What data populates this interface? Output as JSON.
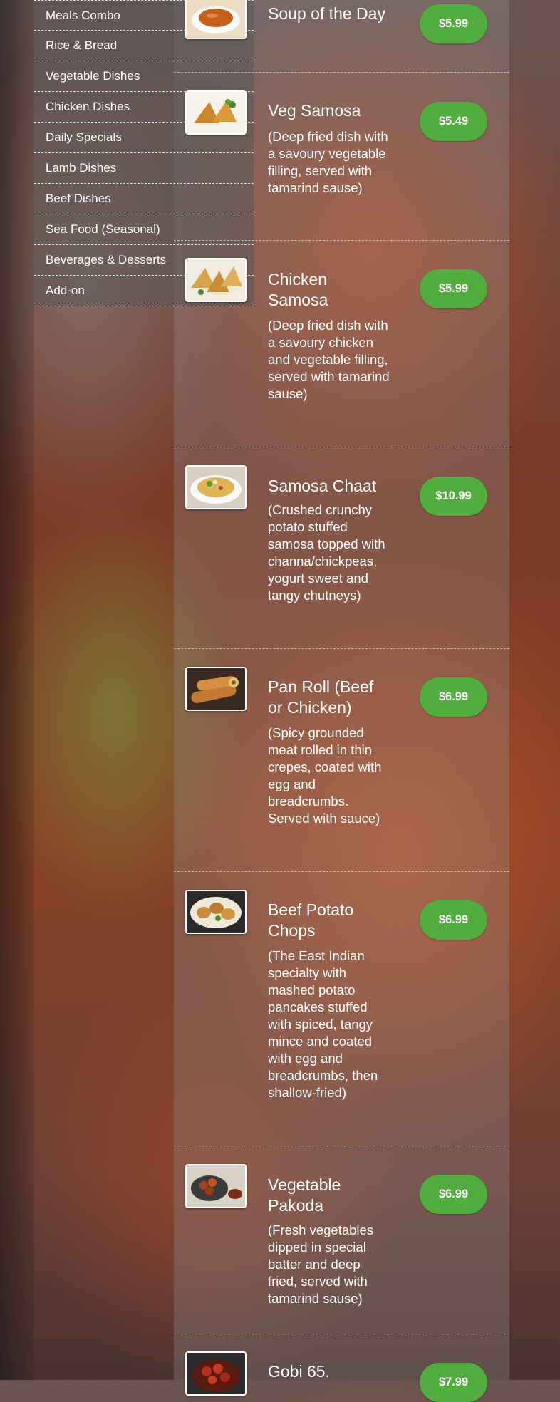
{
  "sidebar": {
    "items": [
      {
        "label": "Meals Combo"
      },
      {
        "label": "Rice & Bread"
      },
      {
        "label": "Vegetable Dishes"
      },
      {
        "label": "Chicken Dishes"
      },
      {
        "label": "Daily Specials"
      },
      {
        "label": "Lamb Dishes"
      },
      {
        "label": "Beef Dishes"
      },
      {
        "label": "Sea Food (Seasonal)"
      },
      {
        "label": "Beverages & Desserts"
      },
      {
        "label": "Add-on"
      }
    ]
  },
  "menu": {
    "items": [
      {
        "name": "Soup of the Day",
        "description": "",
        "price": "$5.99",
        "image": "soup-icon"
      },
      {
        "name": "Veg Samosa",
        "description": "(Deep fried dish with a savoury vegetable filling, served with tamarind sause)",
        "price": "$5.49",
        "image": "samosa-icon"
      },
      {
        "name": "Chicken Samosa",
        "description": "(Deep fried dish with a savoury chicken and vegetable filling, served with tamarind sause)",
        "price": "$5.99",
        "image": "samosa-icon"
      },
      {
        "name": "Samosa Chaat",
        "description": "(Crushed crunchy potato stuffed samosa topped with channa/chickpeas, yogurt sweet and tangy chutneys)",
        "price": "$10.99",
        "image": "chaat-icon"
      },
      {
        "name": "Pan Roll (Beef or Chicken)",
        "description": "(Spicy grounded meat rolled in thin crepes, coated with egg and breadcrumbs. Served with sauce)",
        "price": "$6.99",
        "image": "roll-icon"
      },
      {
        "name": "Beef Potato Chops",
        "description": "(The East Indian specialty with mashed potato pancakes stuffed with spiced, tangy mince and coated with egg and breadcrumbs, then shallow-fried)",
        "price": "$6.99",
        "image": "chops-icon"
      },
      {
        "name": "Vegetable Pakoda",
        "description": "(Fresh vegetables dipped in special batter and deep fried, served with tamarind sause)",
        "price": "$6.99",
        "image": "pakoda-icon"
      },
      {
        "name": "Gobi 65.",
        "description": "",
        "price": "$7.99",
        "image": "gobi-icon"
      }
    ]
  },
  "colors": {
    "price_badge": "#53ad3e",
    "text": "#ffffff"
  }
}
